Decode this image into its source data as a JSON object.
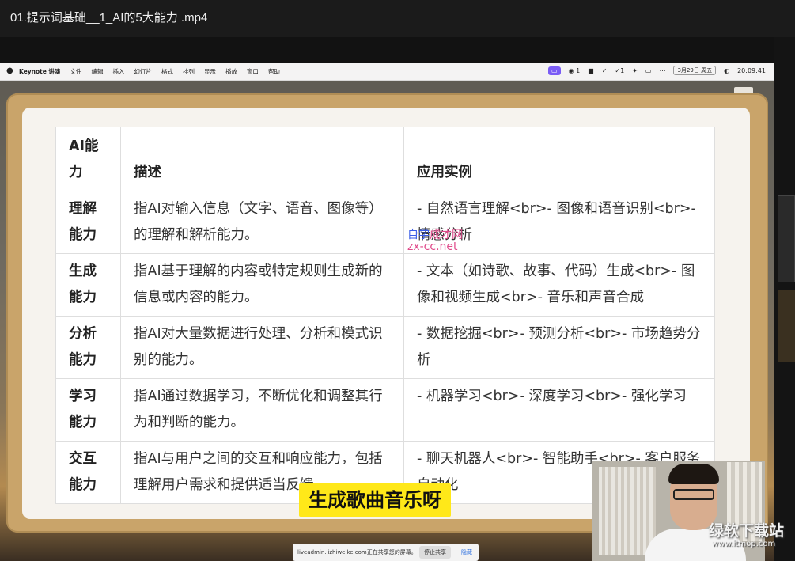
{
  "window": {
    "title": "01.提示词基础__1_AI的5大能力 .mp4"
  },
  "mac_menubar": {
    "apple_icon": "apple-icon",
    "menus": [
      "Keynote 讲演",
      "文件",
      "编辑",
      "插入",
      "幻灯片",
      "格式",
      "排列",
      "显示",
      "播放",
      "窗口",
      "帮助"
    ],
    "tray": {
      "wechat_count": "1",
      "check_count": "1",
      "date": "3月29日 周五",
      "time": "20:09:41"
    }
  },
  "slide_table": {
    "headers": [
      "AI能力",
      "描述",
      "应用实例"
    ],
    "rows": [
      {
        "capability": "理解能力",
        "description": "指AI对输入信息（文字、语音、图像等）的理解和解析能力。",
        "examples": "- 自然语言理解<br>- 图像和语音识别<br>- 情感分析"
      },
      {
        "capability": "生成能力",
        "description": "指AI基于理解的内容或特定规则生成新的信息或内容的能力。",
        "examples": "- 文本（如诗歌、故事、代码）生成<br>- 图像和视频生成<br>- 音乐和声音合成"
      },
      {
        "capability": "分析能力",
        "description": "指AI对大量数据进行处理、分析和模式识别的能力。",
        "examples": "- 数据挖掘<br>- 预测分析<br>- 市场趋势分析"
      },
      {
        "capability": "学习能力",
        "description": "指AI通过数据学习，不断优化和调整其行为和判断的能力。",
        "examples": "- 机器学习<br>- 深度学习<br>- 强化学习"
      },
      {
        "capability": "交互能力",
        "description": "指AI与用户之间的交互和响应能力，包括理解用户需求和提供适当反馈",
        "examples": "- 聊天机器人<br>- 智能助手<br>- 客户服务自动化"
      }
    ]
  },
  "watermark": {
    "line1_a": "自学",
    "line1_b": "成才网",
    "line2": "zx-cc.net"
  },
  "subtitle": "生成歌曲音乐呀",
  "share_bar": {
    "message": "liveadmin.lizhiweike.com正在共享您的屏幕。",
    "stop_label": "停止共享",
    "hide_label": "隐藏"
  },
  "site_watermark": {
    "logo": "绿软下载站",
    "url": "www.itmop.com"
  }
}
